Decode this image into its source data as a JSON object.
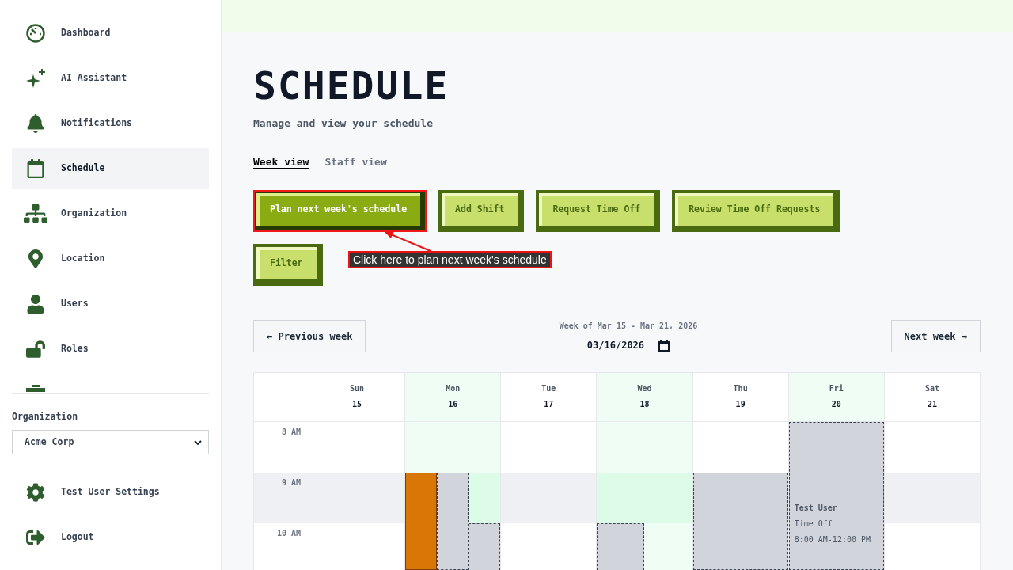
{
  "sidebar": {
    "items": [
      {
        "label": "Dashboard",
        "selected": false
      },
      {
        "label": "AI Assistant",
        "selected": false
      },
      {
        "label": "Notifications",
        "selected": false
      },
      {
        "label": "Schedule",
        "selected": true
      },
      {
        "label": "Organization",
        "selected": false
      },
      {
        "label": "Location",
        "selected": false
      },
      {
        "label": "Users",
        "selected": false
      },
      {
        "label": "Roles",
        "selected": false
      }
    ],
    "organization": {
      "label": "Organization",
      "value": "Acme Corp"
    },
    "footer_items": [
      {
        "label": "Test User Settings"
      },
      {
        "label": "Logout"
      }
    ]
  },
  "page": {
    "title": "SCHEDULE",
    "subtitle": "Manage and view your schedule"
  },
  "tabs": [
    {
      "label": "Week view",
      "selected": true
    },
    {
      "label": "Staff view",
      "selected": false
    }
  ],
  "actions": [
    {
      "label": "Plan next week's schedule",
      "kind": "primary",
      "highlighted": true
    },
    {
      "label": "Add Shift",
      "kind": "secondary",
      "highlighted": false
    },
    {
      "label": "Request Time Off",
      "kind": "secondary",
      "highlighted": false
    },
    {
      "label": "Review Time Off Requests",
      "kind": "secondary",
      "highlighted": false
    },
    {
      "label": "Filter",
      "kind": "secondary",
      "highlighted": false
    }
  ],
  "callout": {
    "text": "Click here to plan next week's schedule"
  },
  "week_nav": {
    "previous": "← Previous week",
    "range": "Week of Mar 15 - Mar 21, 2026",
    "date": "03/16/2026",
    "next": "Next week →"
  },
  "calendar": {
    "days": [
      {
        "name": "Sun",
        "date": "15",
        "highlighted": false
      },
      {
        "name": "Mon",
        "date": "16",
        "highlighted": true
      },
      {
        "name": "Tue",
        "date": "17",
        "highlighted": false
      },
      {
        "name": "Wed",
        "date": "18",
        "highlighted": true
      },
      {
        "name": "Thu",
        "date": "19",
        "highlighted": false
      },
      {
        "name": "Fri",
        "date": "20",
        "highlighted": true
      },
      {
        "name": "Sat",
        "date": "21",
        "highlighted": false
      }
    ],
    "rows": [
      {
        "time": "8 AM",
        "shaded": false,
        "cells": [
          {},
          {},
          {},
          {},
          {},
          {
            "events": [
              {
                "kind": "time_off_full",
                "title": "Test User",
                "subtitle": "Time Off",
                "time": "8:00 AM-12:00 PM"
              }
            ]
          },
          {}
        ]
      },
      {
        "time": "9 AM",
        "shaded": true,
        "cells": [
          {},
          {
            "events": [
              {
                "kind": "shift_third"
              },
              {
                "kind": "time_off_third"
              }
            ]
          },
          {},
          {},
          {
            "events": [
              {
                "kind": "time_off_full"
              }
            ]
          },
          {},
          {}
        ]
      },
      {
        "time": "10 AM",
        "shaded": false,
        "cells": [
          {},
          {
            "events": [
              {
                "kind": "time_off_third"
              }
            ]
          },
          {},
          {
            "events": [
              {
                "kind": "time_off_half"
              }
            ]
          },
          {},
          {},
          {}
        ]
      }
    ]
  }
}
